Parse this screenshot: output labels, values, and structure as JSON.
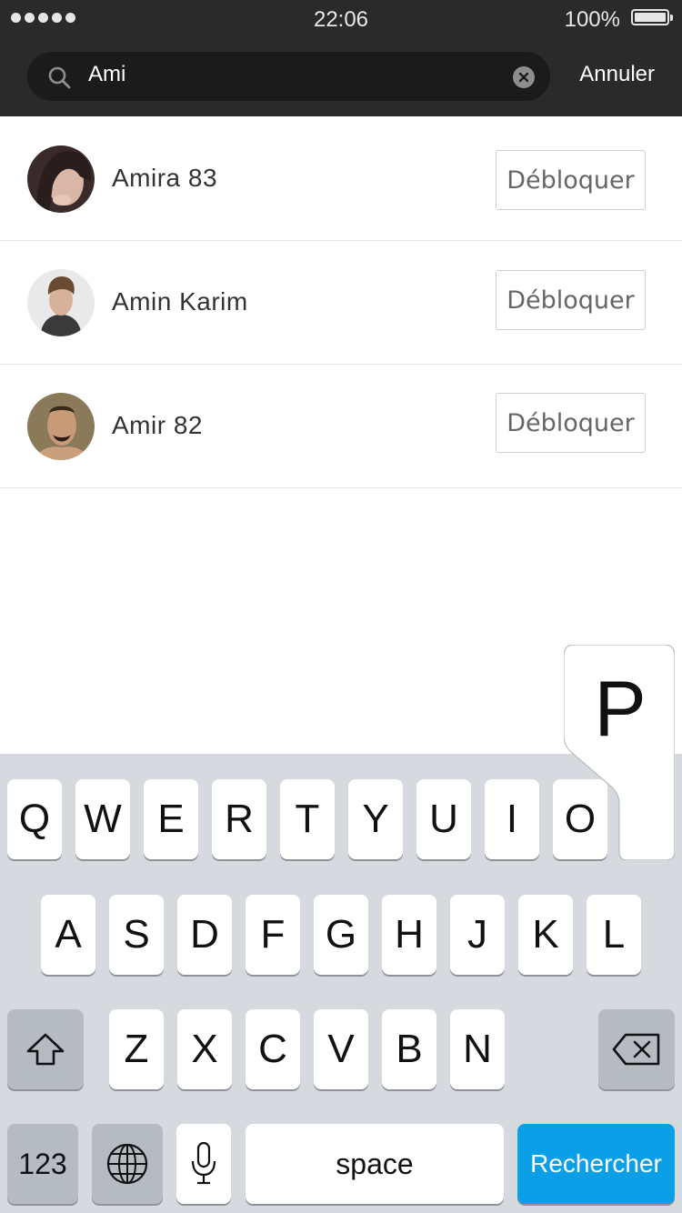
{
  "status_bar": {
    "time": "22:06",
    "battery": "100%"
  },
  "search": {
    "value": "Ami",
    "cancel_label": "Annuler"
  },
  "results": [
    {
      "name": "Amira 83",
      "button": "Débloquer"
    },
    {
      "name": "Amin Karim",
      "button": "Débloquer"
    },
    {
      "name": "Amir 82",
      "button": "Débloquer"
    }
  ],
  "keyboard": {
    "row1": [
      "Q",
      "W",
      "E",
      "R",
      "T",
      "Y",
      "U",
      "I",
      "O"
    ],
    "row2": [
      "A",
      "S",
      "D",
      "F",
      "G",
      "H",
      "J",
      "K",
      "L"
    ],
    "row3": [
      "Z",
      "X",
      "C",
      "V",
      "B",
      "N"
    ],
    "numbers_label": "123",
    "space_label": "space",
    "search_label": "Rechercher",
    "popup_key": "P"
  },
  "colors": {
    "header": "#2a2a2a",
    "keyboard_bg": "#d6dadf",
    "search_key": "#0b9fe8"
  }
}
